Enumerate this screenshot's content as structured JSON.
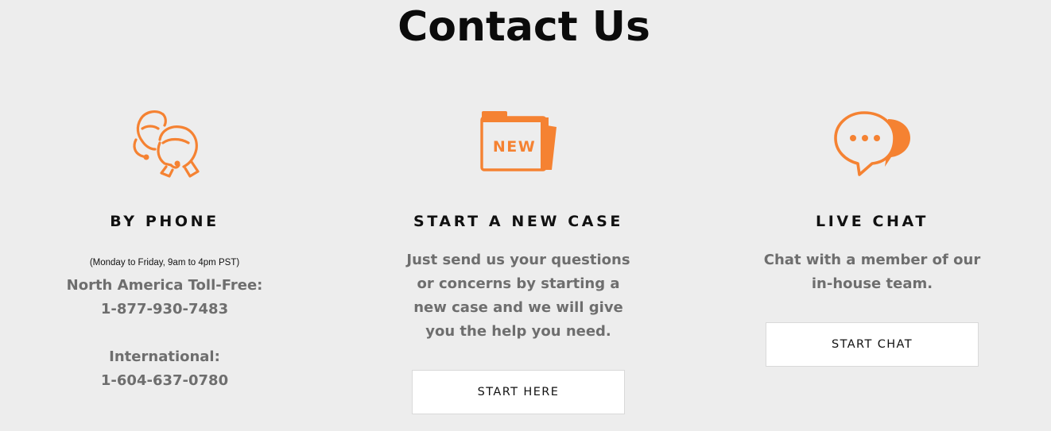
{
  "page": {
    "title": "Contact Us",
    "accent_color": "#f58232",
    "background": "#ededed"
  },
  "columns": {
    "phone": {
      "icon": "headset-support-agents-icon",
      "heading": "BY PHONE",
      "hours": "(Monday to Friday, 9am to 4pm PST)",
      "north_america_label": "North America Toll-Free:",
      "north_america_number": "1-877-930-7483",
      "international_label": "International:",
      "international_number": "1-604-637-0780"
    },
    "case": {
      "icon": "new-folder-icon",
      "icon_text": "NEW",
      "heading": "START A NEW CASE",
      "lines": [
        "Just send us your questions",
        "or concerns by starting a",
        "new case and we will give",
        "you the help you need."
      ],
      "button_label": "START HERE"
    },
    "chat": {
      "icon": "chat-bubbles-icon",
      "heading": "LIVE CHAT",
      "lines": [
        "Chat with a member of our",
        "in-house team."
      ],
      "button_label": "START CHAT"
    }
  }
}
